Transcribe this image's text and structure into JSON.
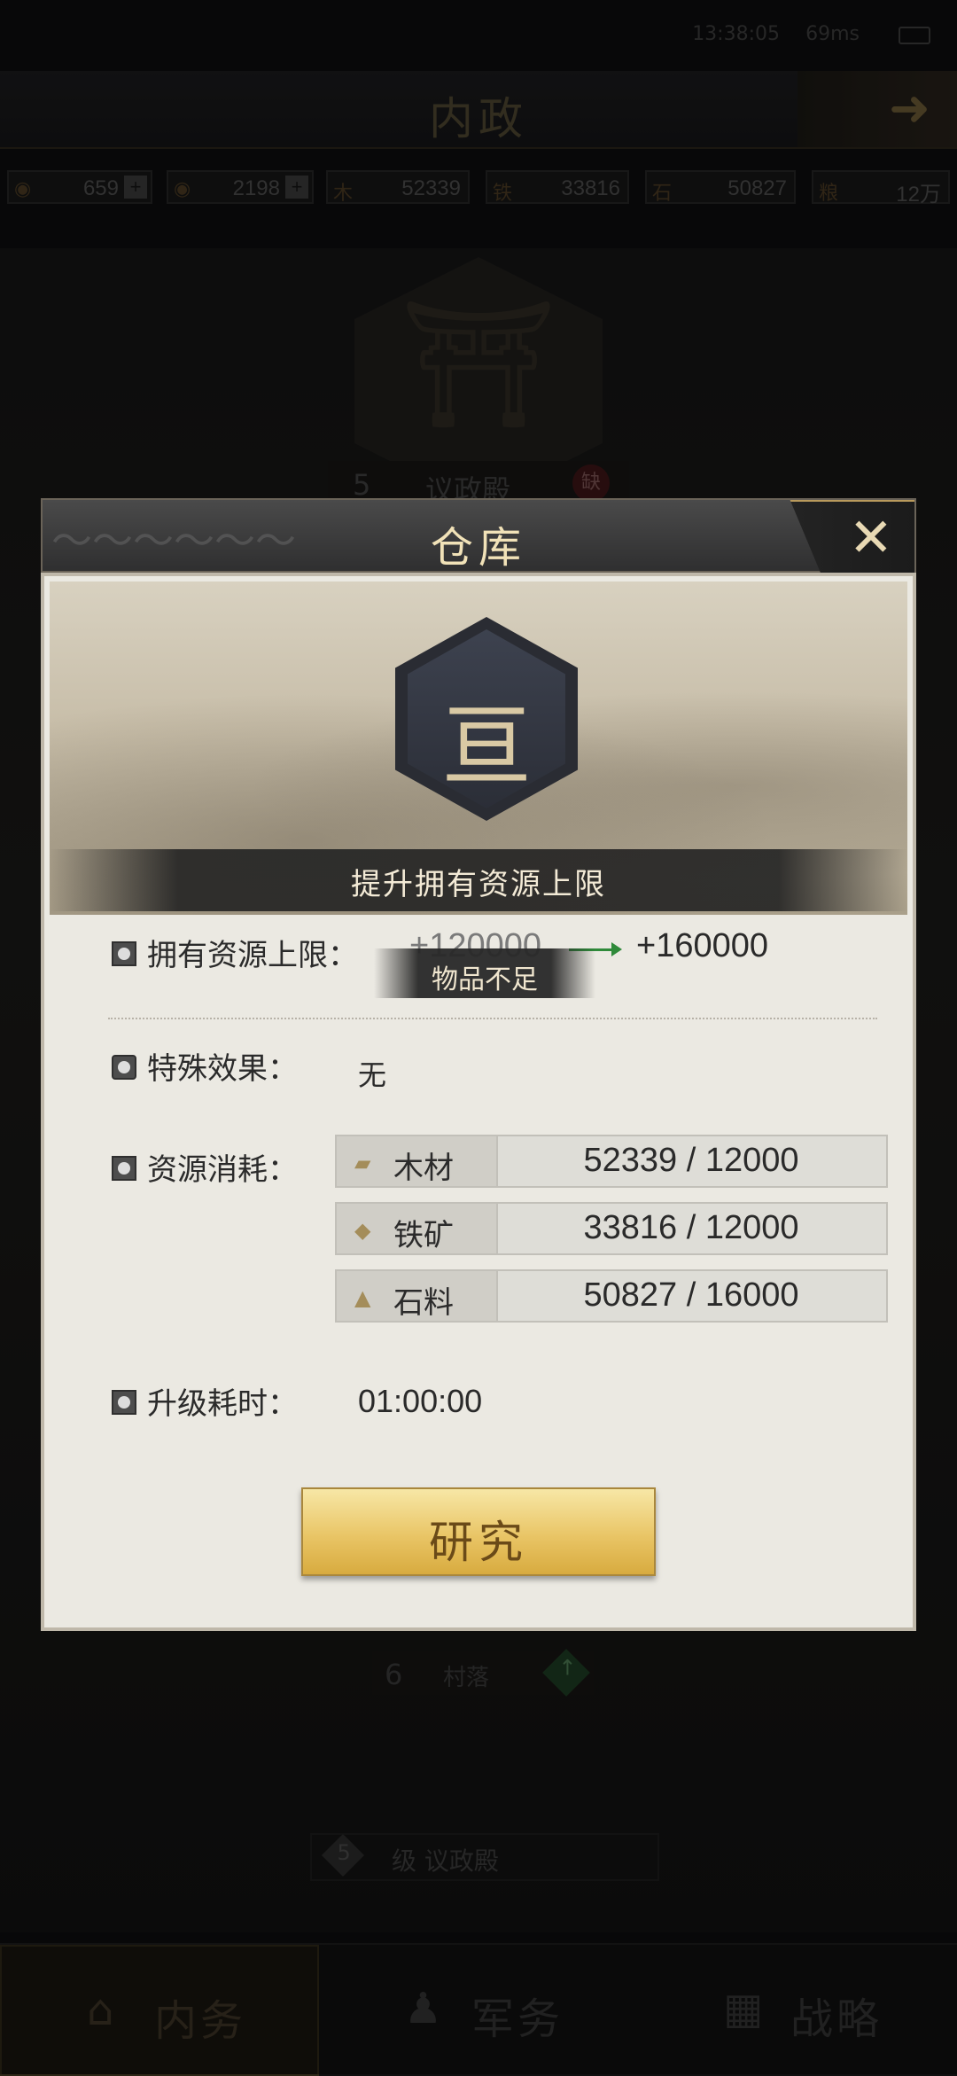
{
  "statusbar": {
    "time": "13:38:05",
    "ping": "69ms"
  },
  "screen": {
    "title": "内政"
  },
  "resources": [
    {
      "icon": "copper-coin-icon",
      "value": "659",
      "plus": "+"
    },
    {
      "icon": "jade-coin-icon",
      "value": "2198",
      "plus": "+"
    },
    {
      "prefix": "木",
      "icon": "wood-icon",
      "value": "52339"
    },
    {
      "prefix": "铁",
      "icon": "iron-icon",
      "value": "33816"
    },
    {
      "prefix": "石",
      "icon": "stone-icon",
      "value": "50827"
    },
    {
      "prefix": "粮",
      "icon": "grain-icon",
      "value": "12万"
    }
  ],
  "background": {
    "hall": {
      "level": "5",
      "name": "议政殿",
      "badge": "缺"
    },
    "village": {
      "level": "6",
      "name": "村落"
    },
    "level_banner": {
      "level": "5",
      "text": "级 议政殿"
    }
  },
  "nav": [
    {
      "label": "内务",
      "icon": "palace-icon",
      "active": true
    },
    {
      "label": "军务",
      "icon": "soldier-icon",
      "active": false
    },
    {
      "label": "战略",
      "icon": "strategy-icon",
      "active": false
    }
  ],
  "dialog": {
    "title": "仓库",
    "banner_caption": "提升拥有资源上限",
    "capacity": {
      "label": "拥有资源上限：",
      "current": "+120000",
      "next": "+160000"
    },
    "toast": "物品不足",
    "effect": {
      "label": "特殊效果：",
      "value": "无"
    },
    "cost": {
      "label": "资源消耗：",
      "items": [
        {
          "name": "木材",
          "icon": "wood-icon",
          "have": "52339",
          "need": "12000",
          "display": "52339 / 12000"
        },
        {
          "name": "铁矿",
          "icon": "iron-icon",
          "have": "33816",
          "need": "12000",
          "display": "33816 / 12000"
        },
        {
          "name": "石料",
          "icon": "stone-icon",
          "have": "50827",
          "need": "16000",
          "display": "50827 / 16000"
        }
      ]
    },
    "upgrade_time": {
      "label": "升级耗时：",
      "value": "01:00:00"
    },
    "research_button": "研究"
  },
  "colors": {
    "gold_button": "#e9c566",
    "dialog_body": "#ebe9e2",
    "arrow_green": "#2f8a3a",
    "title_gold": "#f1e2b8"
  }
}
